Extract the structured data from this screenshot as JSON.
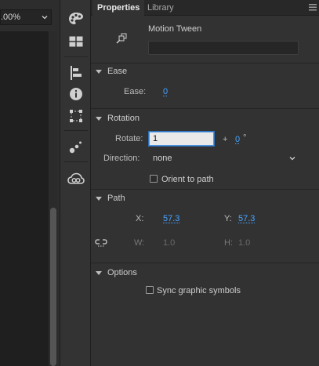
{
  "zoom": {
    "value": ".00%"
  },
  "tabs": [
    {
      "label": "Properties",
      "active": true
    },
    {
      "label": "Library",
      "active": false
    }
  ],
  "object": {
    "type_label": "Motion Tween",
    "instance_name": ""
  },
  "ease": {
    "header": "Ease",
    "label": "Ease:",
    "value": "0"
  },
  "rotation": {
    "header": "Rotation",
    "rotate_label": "Rotate:",
    "rotate_value": "1",
    "plus": "+",
    "degrees_value": "0",
    "degree_symbol": "°",
    "direction_label": "Direction:",
    "direction_value": "none",
    "orient_label": "Orient to path",
    "orient_checked": false
  },
  "path": {
    "header": "Path",
    "x_label": "X:",
    "x_value": "57.3",
    "y_label": "Y:",
    "y_value": "57.3",
    "w_label": "W:",
    "w_value": "1.0",
    "h_label": "H:",
    "h_value": "1.0"
  },
  "options": {
    "header": "Options",
    "sync_label": "Sync graphic symbols",
    "sync_checked": false
  },
  "colors": {
    "accent": "#46a3ff",
    "panel": "#323232",
    "toolstrip": "#333333"
  },
  "tools": [
    "color-palette-icon",
    "swatches-icon",
    "align-icon",
    "info-icon",
    "transform-icon",
    "motion-presets-icon",
    "creative-cloud-libraries-icon"
  ]
}
